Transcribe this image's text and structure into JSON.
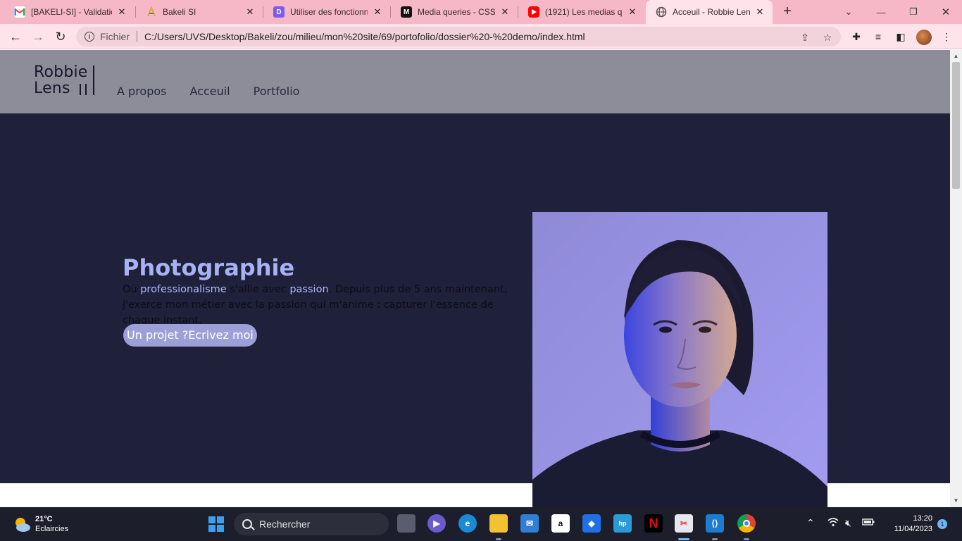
{
  "browser": {
    "tabs": [
      {
        "label": "[BAKELI-SI] - Validation",
        "favicon": "gmail-icon",
        "active": false
      },
      {
        "label": "Bakeli SI",
        "favicon": "bakeli-icon",
        "active": false
      },
      {
        "label": "Utiliser des fonctionnalités",
        "favicon": "docs-icon",
        "active": false
      },
      {
        "label": "Media queries - CSS",
        "favicon": "mdn-icon",
        "active": false
      },
      {
        "label": "(1921) Les medias queries",
        "favicon": "youtube-icon",
        "active": false
      },
      {
        "label": "Acceuil - Robbie Lens",
        "favicon": "globe-icon",
        "active": true
      }
    ],
    "new_tab_label": "+",
    "address": {
      "scheme_label": "Fichier",
      "url": "C:/Users/UVS/Desktop/Bakeli/zou/milieu/mon%20site/69/portofolio/dossier%20-%20demo/index.html"
    }
  },
  "site": {
    "logo_line1": "Robbie",
    "logo_line2": "Lens",
    "nav": [
      "A propos",
      "Acceuil",
      "Portfolio"
    ],
    "hero": {
      "title": "Photographie",
      "text_before": "Où ",
      "highlight1": "professionalisme",
      "text_middle": " s'allie avec ",
      "highlight2": "passion",
      "text_after": ". Depuis plus de 5 ans maintenant, j'exerce mon métier avec la passion qui m'anime : capturer l'essence de chaque instant.",
      "cta": "Un projet ?Ecrivez moi"
    }
  },
  "taskbar": {
    "weather_temp": "21°C",
    "weather_desc": "Eclaircies",
    "search_placeholder": "Rechercher",
    "time": "13:20",
    "date": "11/04/2023",
    "notifications": "1"
  },
  "colors": {
    "tabstrip": "#f6b8c6",
    "header_bg": "#8c8d99",
    "hero_bg": "#1f2039",
    "accent": "#a7b2f4",
    "button_bg": "#9d9fd9"
  }
}
